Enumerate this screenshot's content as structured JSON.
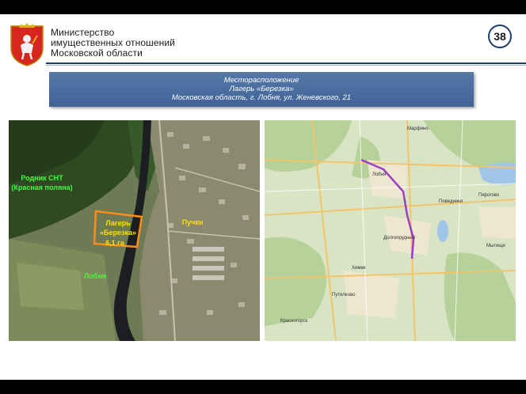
{
  "header": {
    "org_lines": [
      "Министерство",
      "имущественных отношений",
      "Московской области"
    ],
    "page_number": "38"
  },
  "banner": {
    "lines": [
      "Месторасположение",
      "Лагерь «Березка»",
      "Московская область, г. Лобня, ул. Женевского, 21"
    ]
  },
  "satellite": {
    "label_rodnik_1": "Родник СНТ",
    "label_rodnik_2": "(Красная поляна)",
    "label_camp_1": "Лагерь",
    "label_camp_2": "«Березка»",
    "label_area": "6,1 га",
    "label_puchki": "Пучки",
    "label_lobnya": "Лобня"
  },
  "map": {
    "labels": [
      "Лобня",
      "Долгопрудный",
      "Химки",
      "Мытищи",
      "Красногорск",
      "Марфино",
      "Поведники",
      "Пирогово",
      "Путилково"
    ],
    "route_color": "#9b3fc7"
  },
  "colors": {
    "brand": "#1f3d6b",
    "banner": "#4a6fa0",
    "label_green": "#3cff3c",
    "label_yellow": "#ffe000",
    "camp_outline": "#ff8c1a"
  }
}
